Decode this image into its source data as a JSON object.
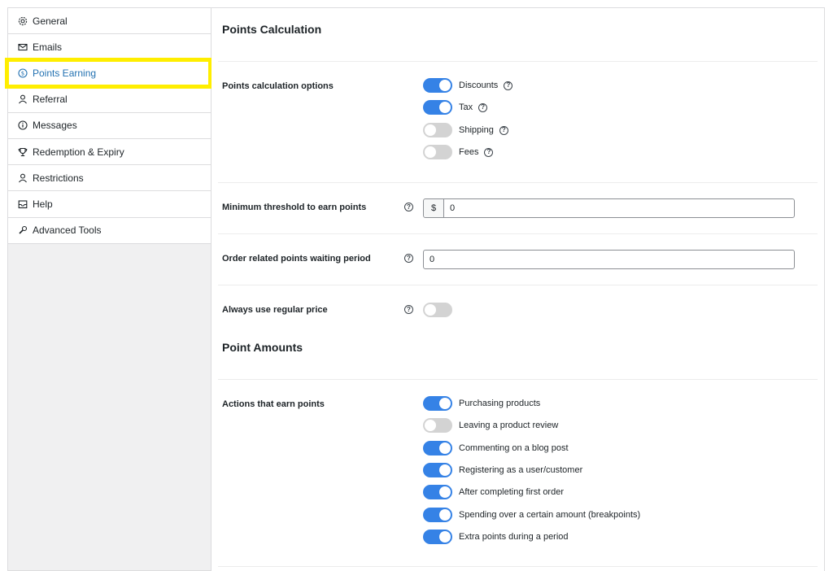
{
  "sidebar": {
    "items": [
      {
        "label": "General",
        "icon": "gear-icon"
      },
      {
        "label": "Emails",
        "icon": "envelope-icon"
      },
      {
        "label": "Points Earning",
        "icon": "dollar-circle-icon"
      },
      {
        "label": "Referral",
        "icon": "person-icon"
      },
      {
        "label": "Messages",
        "icon": "info-icon"
      },
      {
        "label": "Redemption & Expiry",
        "icon": "trophy-icon"
      },
      {
        "label": "Restrictions",
        "icon": "person-icon"
      },
      {
        "label": "Help",
        "icon": "inbox-icon"
      },
      {
        "label": "Advanced Tools",
        "icon": "wrench-icon"
      }
    ],
    "active_index": 2,
    "highlight_color": "#ffee00",
    "active_color": "#2271b1"
  },
  "points_calculation": {
    "title": "Points Calculation",
    "options_label": "Points calculation options",
    "options": [
      {
        "label": "Discounts",
        "enabled": true
      },
      {
        "label": "Tax",
        "enabled": true
      },
      {
        "label": "Shipping",
        "enabled": false
      },
      {
        "label": "Fees",
        "enabled": false
      }
    ],
    "min_threshold": {
      "label": "Minimum threshold to earn points",
      "prefix": "$",
      "value": "0"
    },
    "waiting_period": {
      "label": "Order related points waiting period",
      "value": "0"
    },
    "regular_price": {
      "label": "Always use regular price",
      "enabled": false
    }
  },
  "point_amounts": {
    "title": "Point Amounts",
    "actions_label": "Actions that earn points",
    "actions": [
      {
        "label": "Purchasing products",
        "enabled": true
      },
      {
        "label": "Leaving a product review",
        "enabled": false
      },
      {
        "label": "Commenting on a blog post",
        "enabled": true
      },
      {
        "label": "Registering as a user/customer",
        "enabled": true
      },
      {
        "label": "After completing first order",
        "enabled": true
      },
      {
        "label": "Spending over a certain amount (breakpoints)",
        "enabled": true
      },
      {
        "label": "Extra points during a period",
        "enabled": true
      }
    ]
  },
  "colors": {
    "toggle_on": "#3582e6",
    "toggle_off": "#d3d3d3"
  },
  "help_glyph": "?"
}
